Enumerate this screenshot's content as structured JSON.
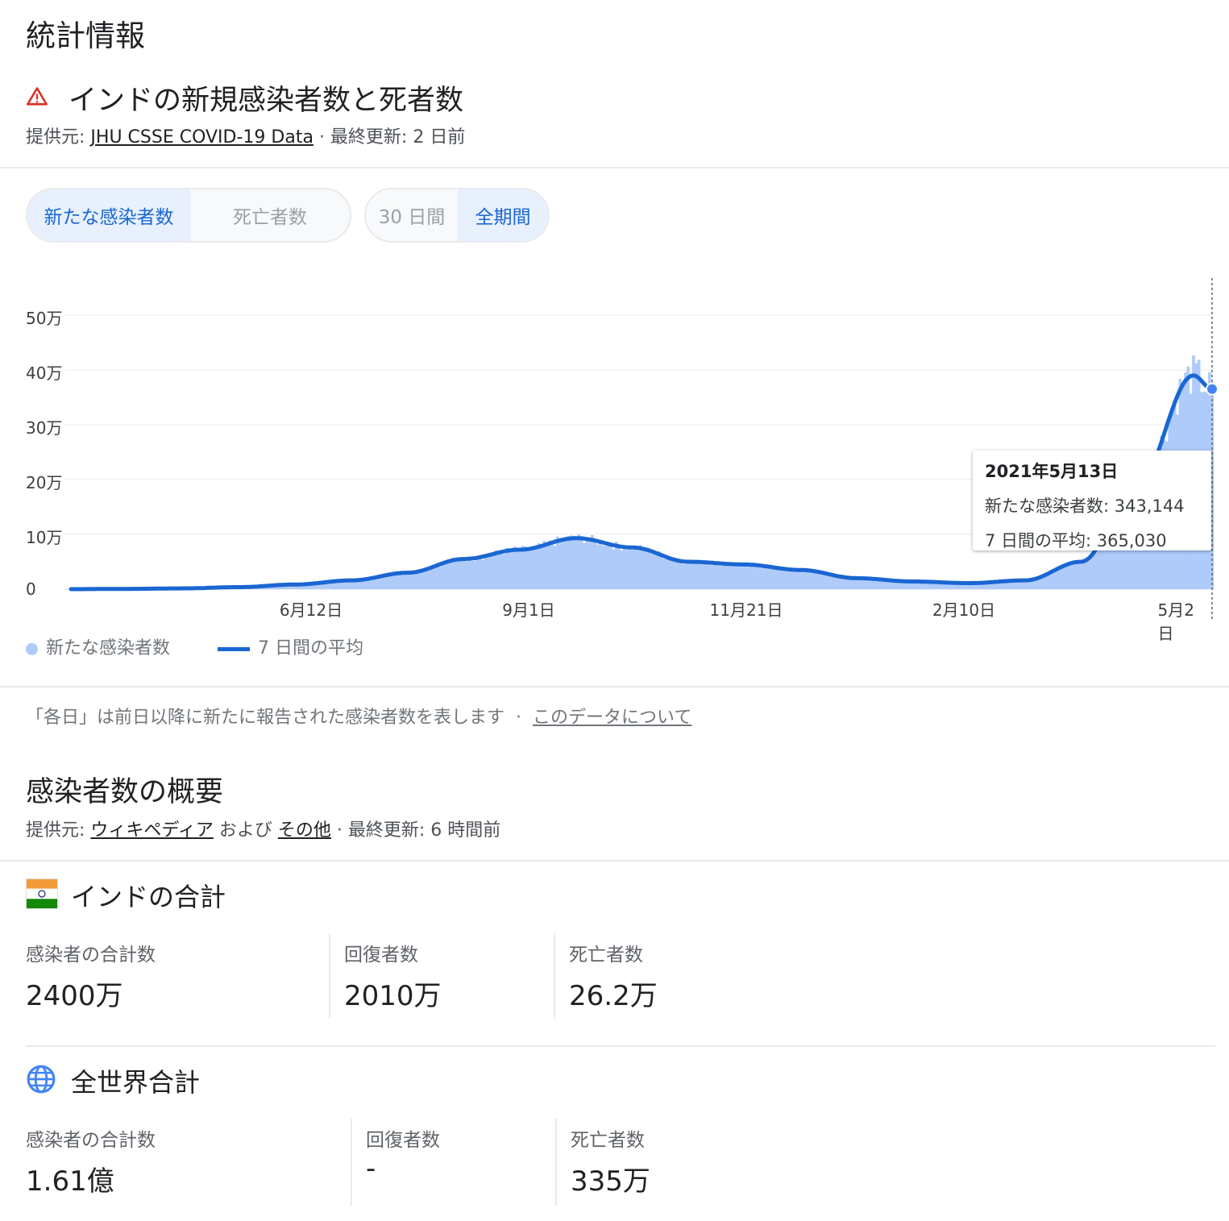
{
  "page_title": "統計情報",
  "section": {
    "title": "インドの新規感染者数と死者数",
    "source_prefix": "提供元: ",
    "source_link": "JHU CSSE COVID-19 Data",
    "source_suffix": " · 最終更新: 2 日前"
  },
  "metric_toggle": {
    "options": [
      "新たな感染者数",
      "死亡者数"
    ],
    "selected": "新たな感染者数"
  },
  "range_toggle": {
    "options": [
      "30 日間",
      "全期間"
    ],
    "selected": "全期間"
  },
  "colors": {
    "accent": "#1967d2",
    "line": "#1a66d2",
    "bars": "#aecbfa",
    "alert": "#d93025"
  },
  "chart_data": {
    "type": "bar",
    "y_ticks": [
      "0",
      "10万",
      "20万",
      "30万",
      "40万",
      "50万"
    ],
    "ylim": [
      0,
      500000
    ],
    "x_ticks": [
      "6月12日",
      "9月1日",
      "11月21日",
      "2月10日",
      "5月2日"
    ],
    "series": [
      {
        "name": "新たな感染者数",
        "kind": "bar"
      },
      {
        "name": "7 日間の平均",
        "kind": "line"
      }
    ],
    "weekly_points": [
      {
        "date": "2020-03-12",
        "avg": 0
      },
      {
        "date": "2020-04-02",
        "avg": 500
      },
      {
        "date": "2020-04-23",
        "avg": 1400
      },
      {
        "date": "2020-05-14",
        "avg": 3700
      },
      {
        "date": "2020-06-04",
        "avg": 8500
      },
      {
        "date": "2020-06-25",
        "avg": 16000
      },
      {
        "date": "2020-07-16",
        "avg": 30000
      },
      {
        "date": "2020-08-06",
        "avg": 55000
      },
      {
        "date": "2020-08-27",
        "avg": 72000
      },
      {
        "date": "2020-09-17",
        "avg": 93000
      },
      {
        "date": "2020-10-08",
        "avg": 76000
      },
      {
        "date": "2020-10-29",
        "avg": 50000
      },
      {
        "date": "2020-11-19",
        "avg": 45000
      },
      {
        "date": "2020-12-10",
        "avg": 35000
      },
      {
        "date": "2020-12-31",
        "avg": 20000
      },
      {
        "date": "2021-01-21",
        "avg": 14000
      },
      {
        "date": "2021-02-11",
        "avg": 11000
      },
      {
        "date": "2021-03-04",
        "avg": 16000
      },
      {
        "date": "2021-03-25",
        "avg": 50000
      },
      {
        "date": "2021-04-15",
        "avg": 190000
      },
      {
        "date": "2021-05-06",
        "avg": 390000
      },
      {
        "date": "2021-05-13",
        "avg": 365030
      }
    ],
    "tooltip": {
      "date": "2021年5月13日",
      "cases_label": "新たな感染者数: 343,144",
      "avg_label": "7 日間の平均: 365,030"
    }
  },
  "chart_note": "「各日」は前日以降に新たに報告された感染者数を表します",
  "chart_note_link": "このデータについて",
  "overview": {
    "title": "感染者数の概要",
    "source_prefix": "提供元: ",
    "link1": "ウィキペディア",
    "and": " および ",
    "link2": "その他",
    "suffix": " · 最終更新: 6 時間前"
  },
  "india": {
    "title": "インドの合計",
    "stats": [
      {
        "label": "感染者の合計数",
        "value": "2400万"
      },
      {
        "label": "回復者数",
        "value": "2010万"
      },
      {
        "label": "死亡者数",
        "value": "26.2万"
      }
    ]
  },
  "world": {
    "title": "全世界合計",
    "stats": [
      {
        "label": "感染者の合計数",
        "value": "1.61億"
      },
      {
        "label": "回復者数",
        "value": "-"
      },
      {
        "label": "死亡者数",
        "value": "335万"
      }
    ]
  }
}
